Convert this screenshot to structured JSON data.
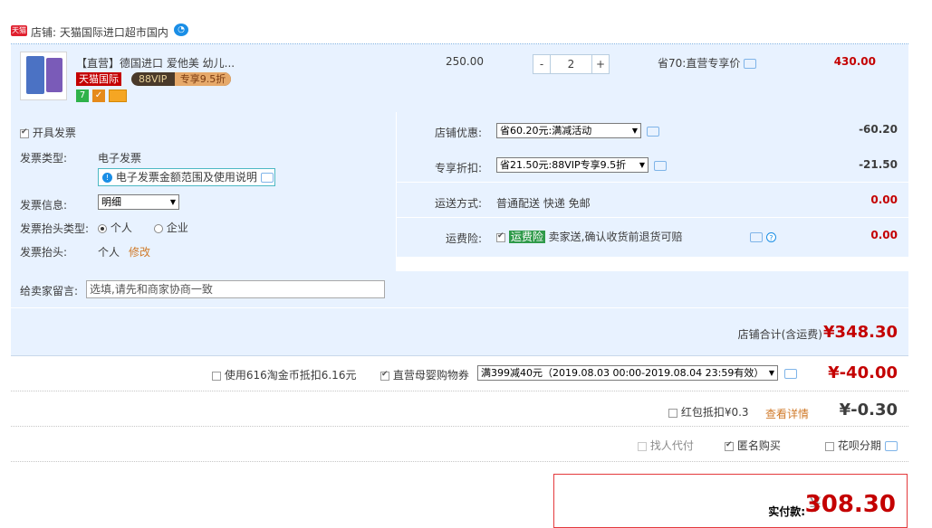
{
  "shop": {
    "badge": "天猫",
    "label": "店铺: 天猫国际进口超市国内"
  },
  "item": {
    "title": "【直营】德国进口 爱他美 幼儿...",
    "badge_tmall": "天猫国际",
    "badge_88vip": "88VIP",
    "badge_discount": "专享9.5折",
    "icon7": "7",
    "price": "250.00",
    "qty_minus": "-",
    "qty": "2",
    "qty_plus": "+",
    "save_note": "省70:直营专享价",
    "subtotal": "430.00"
  },
  "invoice": {
    "open_label": "开具发票",
    "type_label": "发票类型:",
    "type_value": "电子发票",
    "note": "电子发票金额范围及使用说明",
    "info_label": "发票信息:",
    "info_value": "明细",
    "title_type_label": "发票抬头类型:",
    "personal": "个人",
    "company": "企业",
    "header_label": "发票抬头:",
    "header_value": "个人",
    "edit": "修改"
  },
  "promo": {
    "shop_discount_label": "店铺优惠:",
    "shop_discount_value": "省60.20元:满减活动",
    "shop_discount_amount": "-60.20",
    "vip_label": "专享折扣:",
    "vip_value": "省21.50元:88VIP专享9.5折",
    "vip_amount": "-21.50",
    "ship_label": "运送方式:",
    "ship_value": "普通配送 快递 免邮",
    "ship_amount": "0.00",
    "insure_label": "运费险:",
    "insure_tag": "运费险",
    "insure_value": "卖家送,确认收货前退货可赔",
    "insure_amount": "0.00"
  },
  "message": {
    "label": "给卖家留言:",
    "placeholder": "选填,请先和商家协商一致"
  },
  "shop_total": {
    "label": "店铺合计(含运费)",
    "value": "¥348.30"
  },
  "coupon": {
    "coin_label": "使用616淘金币抵扣6.16元",
    "coupon_label": "直营母婴购物券",
    "coupon_value": "满399减40元（2019.08.03 00:00-2019.08.04 23:59有效）",
    "amount": "¥-40.00"
  },
  "hongbao": {
    "label": "红包抵扣¥0.3",
    "detail": "查看详情",
    "amount": "¥-0.30"
  },
  "options": {
    "proxy": "找人代付",
    "anon": "匿名购买",
    "huabei": "花呗分期"
  },
  "pay": {
    "label": "实付款:",
    "currency": "¥",
    "amount": "308.30"
  },
  "colors": {
    "accent_red": "#c40000",
    "panel_blue": "#e8f2ff",
    "border_red": "#e4393c"
  }
}
